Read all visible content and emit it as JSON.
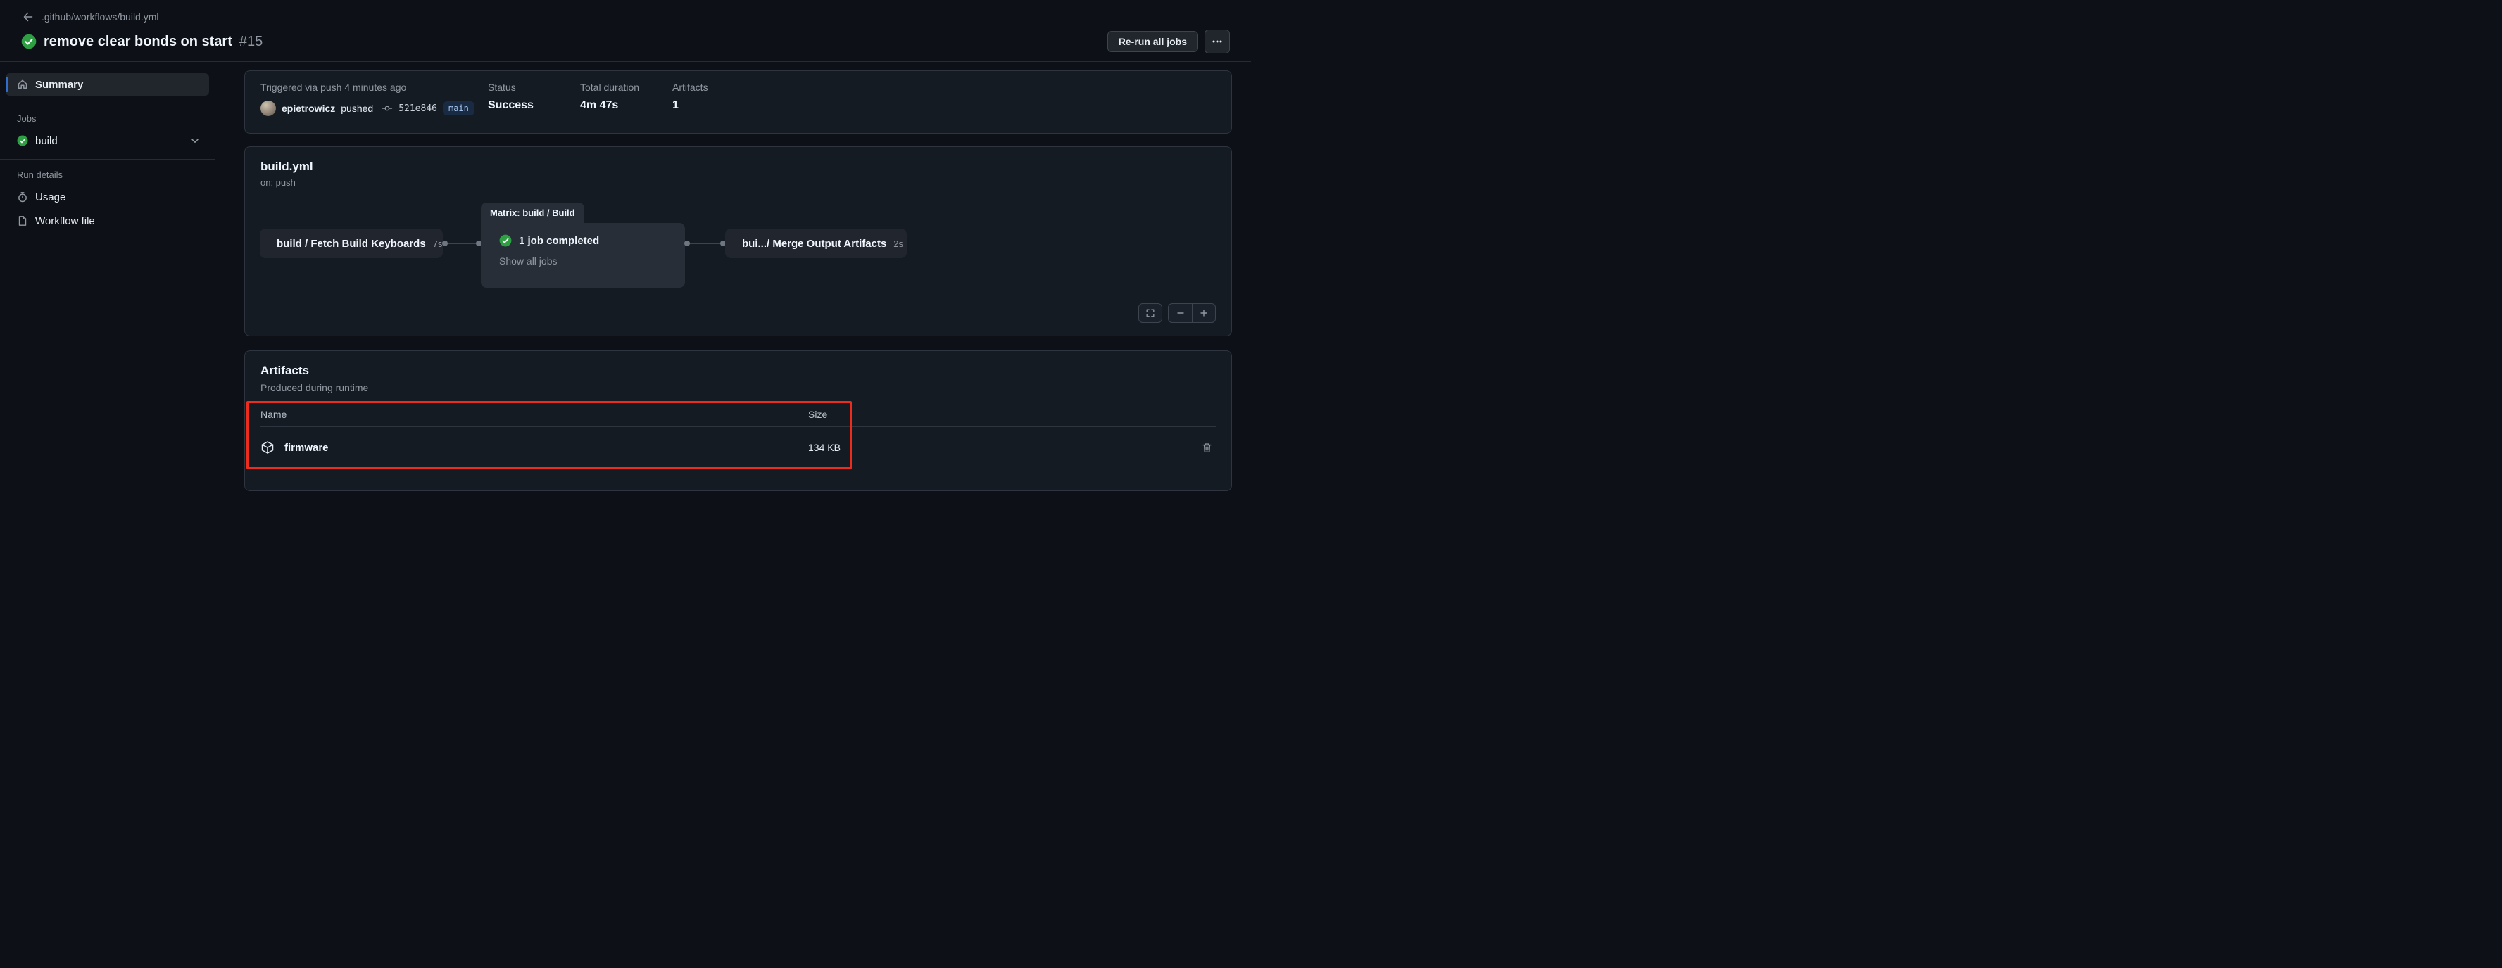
{
  "colors": {
    "accent_blue": "#316dca",
    "success_green": "#2ea043",
    "annotation_red": "#ee2c1e",
    "background": "#0d1117",
    "card_background": "#151b23"
  },
  "header": {
    "breadcrumb": ".github/workflows/build.yml",
    "title": "remove clear bonds on start",
    "run_number": "#15",
    "rerun_button": "Re-run all jobs"
  },
  "sidebar": {
    "summary": "Summary",
    "jobs_section": "Jobs",
    "job_build": "build",
    "run_details_section": "Run details",
    "usage": "Usage",
    "workflow_file": "Workflow file"
  },
  "run_info": {
    "triggered": "Triggered via push 4 minutes ago",
    "actor": "epietrowicz",
    "action": "pushed",
    "commit_sha": "521e846",
    "branch": "main",
    "columns": [
      {
        "label": "Status",
        "value": "Success"
      },
      {
        "label": "Total duration",
        "value": "4m 47s"
      },
      {
        "label": "Artifacts",
        "value": "1"
      }
    ]
  },
  "graph": {
    "file": "build.yml",
    "trigger": "on: push",
    "node_fetch": {
      "label": "build / Fetch Build Keyboards",
      "duration": "7s"
    },
    "matrix": {
      "tab": "Matrix: build / Build",
      "summary": "1 job completed",
      "link": "Show all jobs"
    },
    "node_merge": {
      "label": "bui.../ Merge Output Artifacts",
      "duration": "2s"
    }
  },
  "artifacts": {
    "title": "Artifacts",
    "subtitle": "Produced during runtime",
    "col_name": "Name",
    "col_size": "Size",
    "rows": [
      {
        "name": "firmware",
        "size": "134 KB"
      }
    ]
  },
  "icons": {
    "arrow-left-icon": "←",
    "check-circle-icon": "green circle with check",
    "home-icon": "⌂",
    "chevron-down-icon": "⌄",
    "stopwatch-icon": "⏱",
    "workflow-file-icon": "document page",
    "git-commit-icon": "—o—",
    "kebab-icon": "⋯",
    "package-icon": "3d box outline",
    "trash-icon": "trash can",
    "expand-icon": "fullscreen corners",
    "zoom-out-icon": "−",
    "zoom-in-icon": "+"
  }
}
